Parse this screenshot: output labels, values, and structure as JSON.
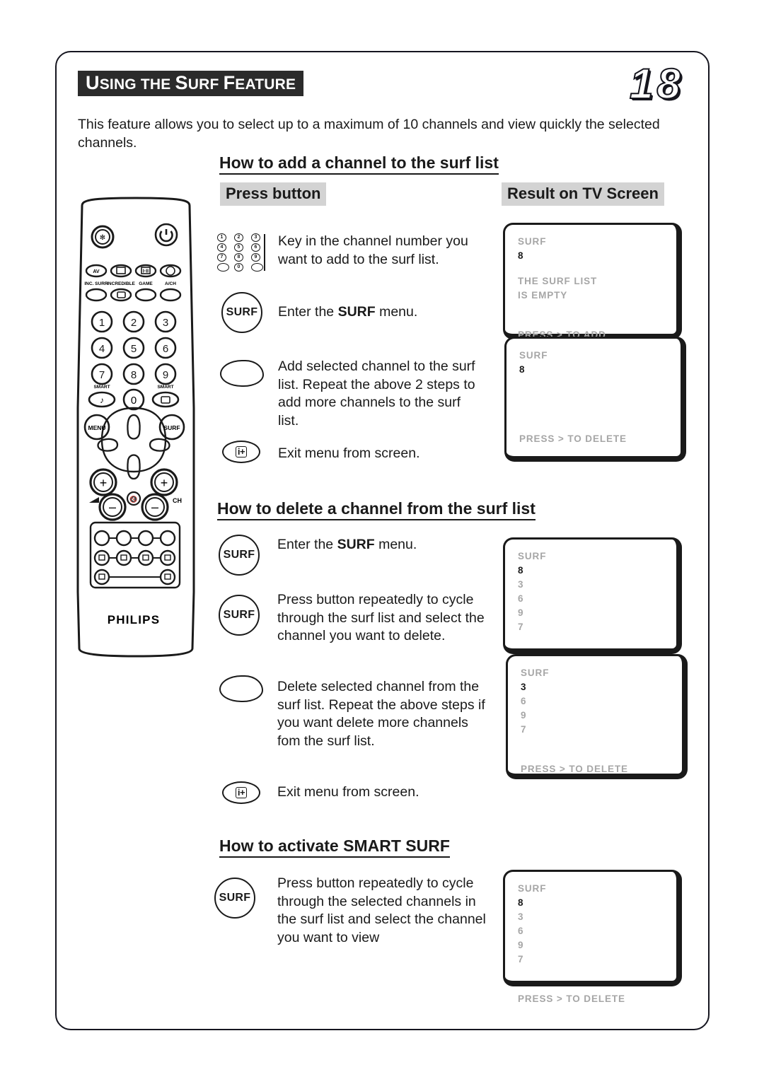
{
  "page": {
    "title_first_letters": [
      "U",
      "S",
      "F"
    ],
    "title_parts": [
      {
        "big": "U",
        "small": "SING"
      },
      {
        "big": "",
        "small": " THE "
      },
      {
        "big": "S",
        "small": "URF"
      },
      {
        "big": "",
        "small": " "
      },
      {
        "big": "F",
        "small": "EATURE"
      }
    ],
    "title_text": "Using the Surf Feature",
    "number": "18",
    "intro": "This feature allows you to select up to a maximum of 10 channels and view quickly the selected channels."
  },
  "columns": {
    "press_button": "Press button",
    "result_on_tv": "Result on TV Screen"
  },
  "sections": [
    {
      "id": "add",
      "heading": "How to add a channel to the surf list",
      "steps": [
        {
          "icon": "numeric-keypad-icon",
          "text": "Key in the channel number you want to add to the surf list."
        },
        {
          "icon": "surf-button-icon",
          "label": "SURF",
          "text_html": "Enter the <b>SURF</b> menu.",
          "text": "Enter the SURF menu."
        },
        {
          "icon": "right-arrow-button-icon",
          "text": "Add selected channel to the surf list. Repeat the above  2 steps to add more channels to the surf list."
        },
        {
          "icon": "info-plus-button-icon",
          "label": "i+",
          "text": "Exit menu from screen."
        }
      ]
    },
    {
      "id": "delete",
      "heading": "How to delete a channel from the surf list",
      "steps": [
        {
          "icon": "surf-button-icon",
          "label": "SURF",
          "text_html": "Enter the <b>SURF</b> menu.",
          "text": "Enter the SURF menu."
        },
        {
          "icon": "surf-button-icon",
          "label": "SURF",
          "text": "Press button repeatedly to cycle through the surf list and select the channel you want to delete."
        },
        {
          "icon": "right-arrow-button-icon",
          "text": "Delete selected channel from the surf list. Repeat the above steps if you want delete more channels fom the surf list."
        },
        {
          "icon": "info-plus-button-icon",
          "label": "i+",
          "text": "Exit menu from screen."
        }
      ]
    },
    {
      "id": "smart",
      "heading": "How to activate SMART SURF",
      "steps": [
        {
          "icon": "surf-button-icon",
          "label": "SURF",
          "text": "Press button repeatedly to cycle through the selected channels in the surf list and select the channel you want to view"
        }
      ]
    }
  ],
  "tv_screens": [
    {
      "id": "screen-add-empty",
      "lines": [
        {
          "text": "SURF",
          "selected": false
        },
        {
          "text": "8",
          "selected": true
        },
        {
          "gap": "md"
        },
        {
          "text": "THE SURF LIST",
          "selected": false
        },
        {
          "text": "IS EMPTY",
          "selected": false
        },
        {
          "gap": "lg"
        },
        {
          "text": "PRESS >  TO ADD",
          "selected": false
        }
      ]
    },
    {
      "id": "screen-add-added",
      "lines": [
        {
          "text": "SURF",
          "selected": false
        },
        {
          "text": "8",
          "selected": true
        },
        {
          "gap": "xxl"
        },
        {
          "text": "PRESS >  TO DELETE",
          "selected": false
        }
      ]
    },
    {
      "id": "screen-delete-list",
      "lines": [
        {
          "text": "SURF",
          "selected": false
        },
        {
          "text": "8",
          "selected": true
        },
        {
          "text": "3",
          "selected": false
        },
        {
          "text": "6",
          "selected": false
        },
        {
          "text": "9",
          "selected": false
        },
        {
          "text": "7",
          "selected": false
        },
        {
          "gap": "lg"
        },
        {
          "text": "PRESS >  TO DELETE",
          "selected": false
        }
      ]
    },
    {
      "id": "screen-delete-after",
      "lines": [
        {
          "text": "SURF",
          "selected": false
        },
        {
          "text": "3",
          "selected": true
        },
        {
          "text": "6",
          "selected": false
        },
        {
          "text": "9",
          "selected": false
        },
        {
          "text": "7",
          "selected": false
        },
        {
          "gap": "lg"
        },
        {
          "text": "PRESS >  TO DELETE",
          "selected": false
        }
      ]
    },
    {
      "id": "screen-smart-surf",
      "lines": [
        {
          "text": "SURF",
          "selected": false
        },
        {
          "text": "8",
          "selected": true
        },
        {
          "text": "3",
          "selected": false
        },
        {
          "text": "6",
          "selected": false
        },
        {
          "text": "9",
          "selected": false
        },
        {
          "text": "7",
          "selected": false
        },
        {
          "gap": "md"
        },
        {
          "text": "PRESS >  TO DELETE",
          "selected": false
        }
      ]
    }
  ],
  "remote": {
    "brand": "PHILIPS",
    "labels_row": [
      "AV",
      "INCREDIBLE-ICON",
      "H-II",
      "POWER-SMALL"
    ],
    "sub_labels": [
      "INC. SURR",
      "INCREDIBLE",
      "GAME",
      "A/CH"
    ],
    "keypad": [
      "1",
      "2",
      "3",
      "4",
      "5",
      "6",
      "7",
      "8",
      "9",
      "0"
    ],
    "smart_left": "SMART",
    "smart_right": "SMART",
    "menu": "MENU",
    "surf": "SURF",
    "volume_symbol": "◿",
    "channel_label": "CH",
    "plus": "+",
    "minus": "−"
  },
  "colors": {
    "ink": "#1a1a1a",
    "osd_gray": "#a6a6a6",
    "header_gray": "#d3d3d3",
    "banner_black": "#2b2b2b"
  }
}
